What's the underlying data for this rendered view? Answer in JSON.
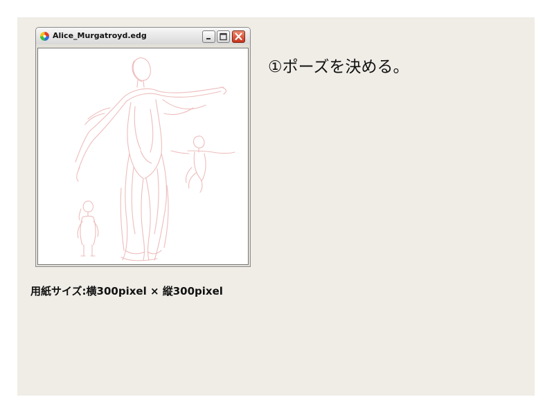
{
  "window": {
    "title": "Alice_Murgatroyd.edg",
    "icon": "palette-icon",
    "buttons": [
      "minimize-icon",
      "maximize-icon",
      "close-icon"
    ]
  },
  "heading": "①ポーズを決める。",
  "caption": "用紙サイズ:横300pixel × 縦300pixel",
  "colors": {
    "slide_background": "#f0ede7",
    "sketch_stroke": "#eebcbc",
    "close_button": "#d8482c"
  }
}
